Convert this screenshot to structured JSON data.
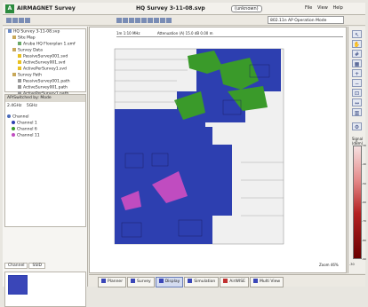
{
  "app": {
    "name": "AIRMAGNET Survey",
    "title": "HQ Survey 3-11-08.svp",
    "help": "(unknown)"
  },
  "menu": [
    "File",
    "View",
    "Help"
  ],
  "toolbar": {
    "mode": "802.11n AP Operation Mode"
  },
  "tree": {
    "root": "HQ Survey 3-11-08.svp",
    "site_map": "Site Map",
    "floorplan": "Aruba HQ Floorplan 1.emf",
    "survey_data": "Survey Data",
    "files": [
      "PassiveSurvey001.svd",
      "ActiveSurvey001.svd",
      "ActivePerSurvey1.svd"
    ],
    "survey_path": "Survey Path",
    "paths": [
      "PassiveSurvey001.path",
      "ActiveSurvey001.path",
      "ActivePerSurvey1.path"
    ]
  },
  "legend": {
    "header": "AP/Switched by: Mode",
    "band1": "2.4GHz",
    "band2": "5GHz",
    "channel": "Channel",
    "items": [
      "Channel 1",
      "Channel 6",
      "Channel 11"
    ],
    "colors": [
      "#2d3fb0",
      "#3a9a2a",
      "#c04cc0"
    ]
  },
  "tabs": {
    "channel": "Channel",
    "ssid": "SSID"
  },
  "map": {
    "ruler": "1m 1:10 MHz",
    "info": "Attenuation (A) 15.0 dB  0.00 m",
    "scale": "Zoom 46%"
  },
  "right": {
    "label": "Signal (dBm)",
    "ticks": [
      "-30",
      "-40",
      "-50",
      "-60",
      "-70",
      "-80",
      "-90"
    ]
  },
  "bottom": {
    "tabs": [
      "Planner",
      "Survey",
      "Display",
      "Simulation",
      "AirWISE",
      "Multi View"
    ],
    "active": "Display"
  }
}
